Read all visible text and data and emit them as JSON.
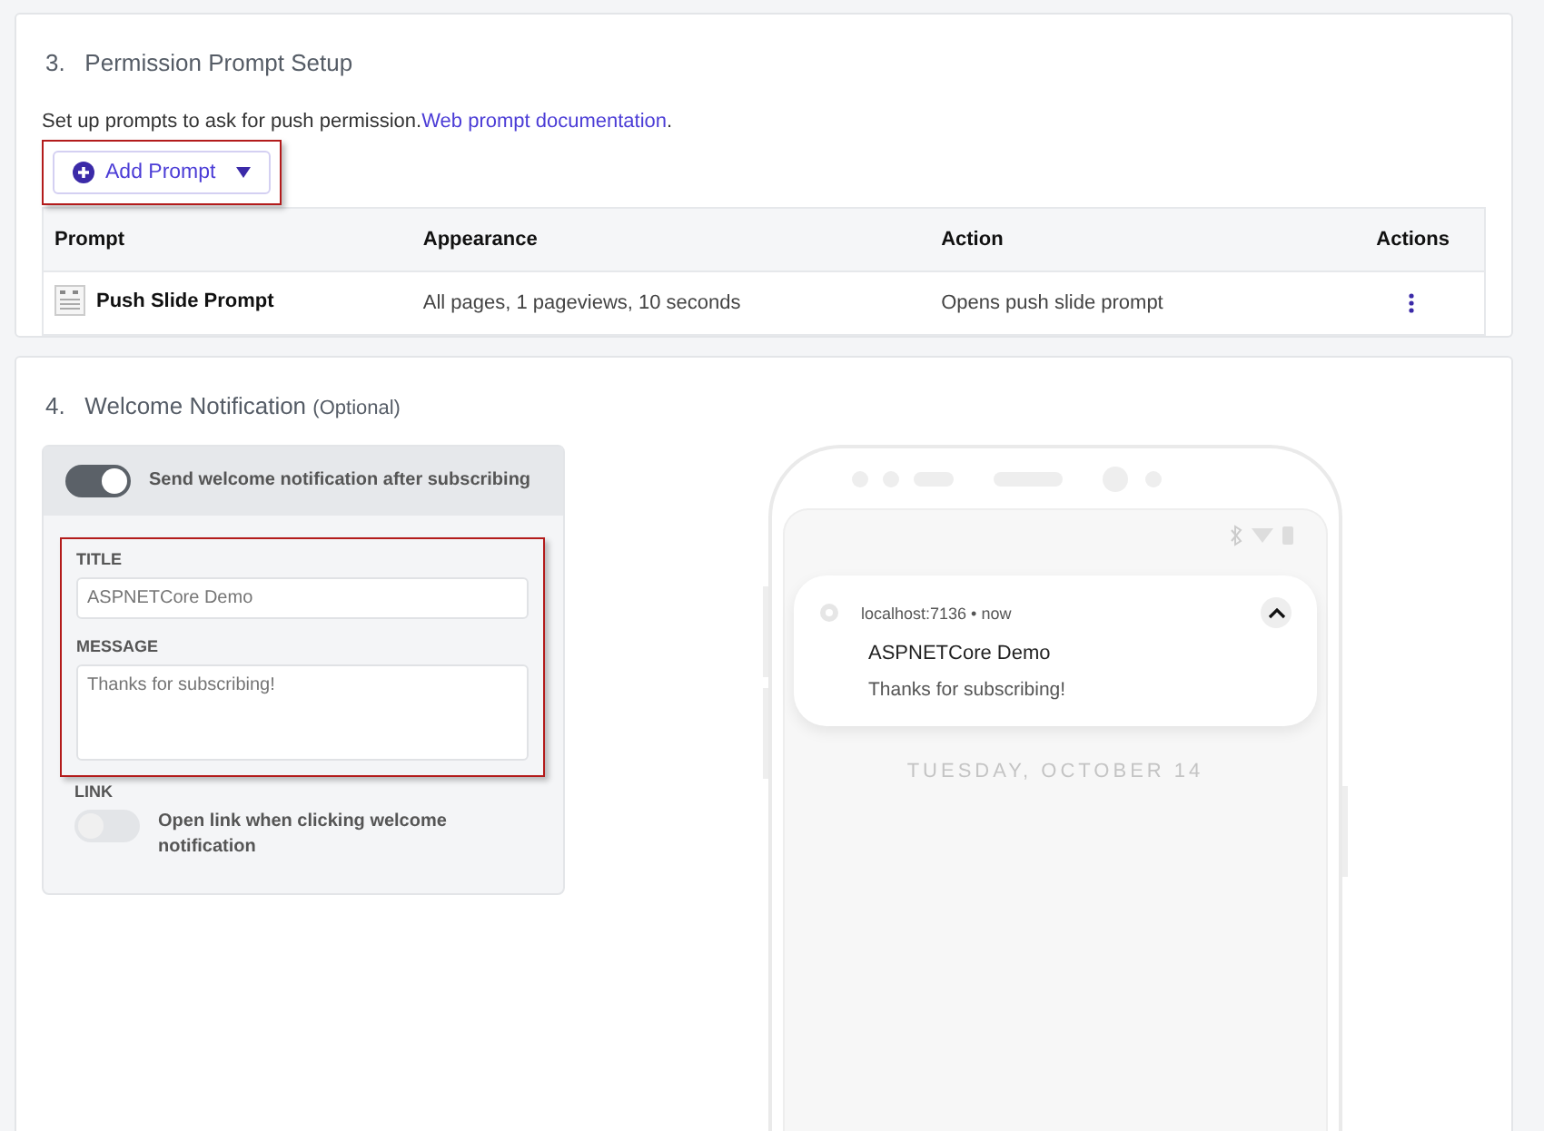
{
  "permission_section": {
    "number": "3.",
    "title": "Permission Prompt Setup",
    "description": "Set up prompts to ask for push permission.",
    "doc_link": "Web prompt documentation",
    "after_link": ".",
    "add_prompt": {
      "label": "Add Prompt",
      "highlighted": true
    },
    "table": {
      "columns": [
        "Prompt",
        "Appearance",
        "Action",
        "Actions"
      ],
      "rows": [
        {
          "prompt": "Push Slide Prompt",
          "appearance": "All pages, 1 pageviews, 10 seconds",
          "action": "Opens push slide prompt"
        }
      ]
    }
  },
  "welcome_section": {
    "number": "4.",
    "title": "Welcome Notification",
    "optional": "(Optional)",
    "send_toggle": {
      "label": "Send welcome notification after subscribing",
      "on": true
    },
    "fields_highlighted": true,
    "fields": [
      {
        "kind": "input",
        "label": "TITLE",
        "placeholder": "ASPNETCore Demo"
      },
      {
        "kind": "textarea",
        "label": "MESSAGE",
        "placeholder": "Thanks for subscribing!"
      }
    ],
    "link": {
      "label": "LINK",
      "toggle_label": "Open link when clicking welcome notification",
      "on": false
    },
    "preview": {
      "source": "localhost:7136 • now",
      "title": "ASPNETCore Demo",
      "message": "Thanks for subscribing!",
      "date": "TUESDAY, OCTOBER 14"
    }
  }
}
